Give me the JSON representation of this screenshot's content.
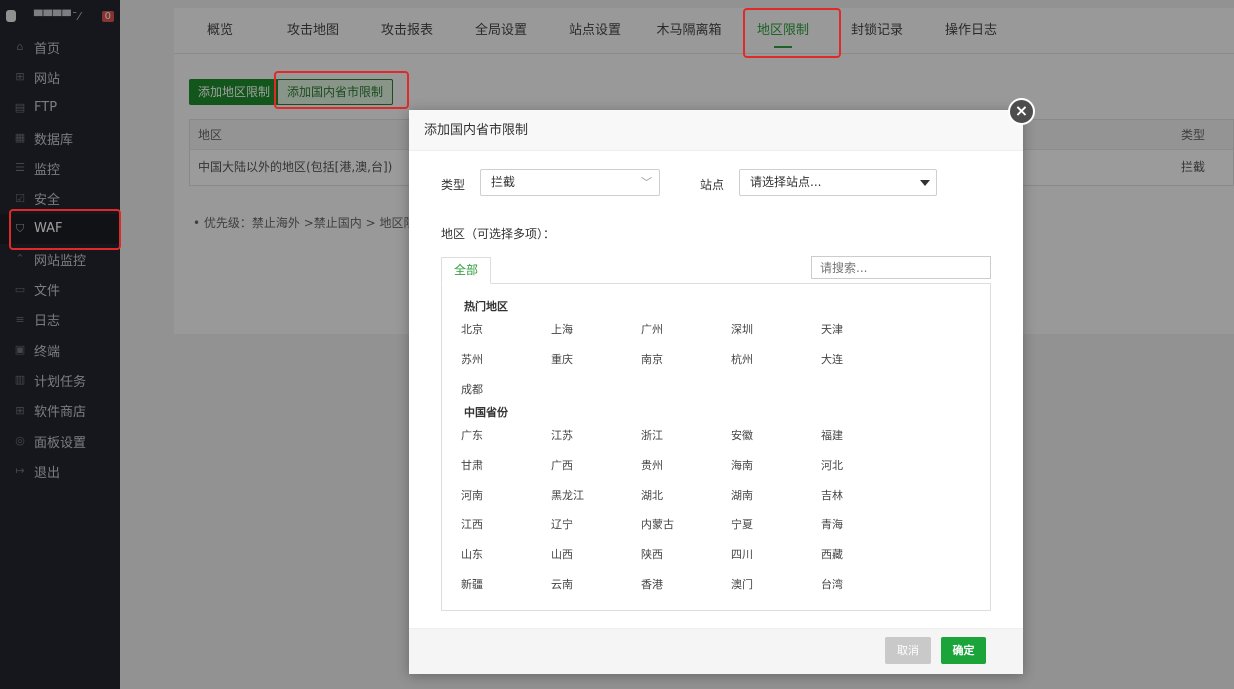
{
  "sidebar": {
    "host": "▀▀▀▀ˉ⁄",
    "badge": "0",
    "items": [
      {
        "label": "首页",
        "icon": "⌂"
      },
      {
        "label": "网站",
        "icon": "⊞"
      },
      {
        "label": "FTP",
        "icon": "▤"
      },
      {
        "label": "数据库",
        "icon": "▦"
      },
      {
        "label": "监控",
        "icon": "☰"
      },
      {
        "label": "安全",
        "icon": "☑"
      },
      {
        "label": "WAF",
        "icon": "⛉"
      },
      {
        "label": "网站监控",
        "icon": "⌃"
      },
      {
        "label": "文件",
        "icon": "▭"
      },
      {
        "label": "日志",
        "icon": "≡"
      },
      {
        "label": "终端",
        "icon": "▣"
      },
      {
        "label": "计划任务",
        "icon": "▥"
      },
      {
        "label": "软件商店",
        "icon": "⊞"
      },
      {
        "label": "面板设置",
        "icon": "◎"
      },
      {
        "label": "退出",
        "icon": "↦"
      }
    ]
  },
  "tabs": [
    "概览",
    "攻击地图",
    "攻击报表",
    "全局设置",
    "站点设置",
    "木马隔离箱",
    "地区限制",
    "封锁记录",
    "操作日志"
  ],
  "buttons": {
    "add_region": "添加地区限制",
    "add_province": "添加国内省市限制"
  },
  "bg_table": {
    "col_region": "地区",
    "col_type": "类型",
    "row_region": "中国大陆以外的地区(包括[港,澳,台])",
    "row_type": "拦截"
  },
  "note": "•  优先级：禁止海外 >禁止国内 > 地区限制",
  "modal": {
    "title": "添加国内省市限制",
    "close": "×",
    "type_label": "类型",
    "type_value": "拦截",
    "site_label": "站点",
    "site_placeholder": "请选择站点...",
    "region_label": "地区（可选择多项）：",
    "tab_all": "全部",
    "search_placeholder": "请搜索...",
    "hot_title": "热门地区",
    "hot_cities": [
      "北京",
      "上海",
      "广州",
      "深圳",
      "天津",
      "苏州",
      "重庆",
      "南京",
      "杭州",
      "大连",
      "成都"
    ],
    "province_title": "中国省份",
    "provinces": [
      "广东",
      "江苏",
      "浙江",
      "安徽",
      "福建",
      "甘肃",
      "广西",
      "贵州",
      "海南",
      "河北",
      "河南",
      "黑龙江",
      "湖北",
      "湖南",
      "吉林",
      "江西",
      "辽宁",
      "内蒙古",
      "宁夏",
      "青海",
      "山东",
      "山西",
      "陕西",
      "四川",
      "西藏",
      "新疆",
      "云南",
      "香港",
      "澳门",
      "台湾"
    ],
    "cancel": "取消",
    "ok": "确定"
  }
}
